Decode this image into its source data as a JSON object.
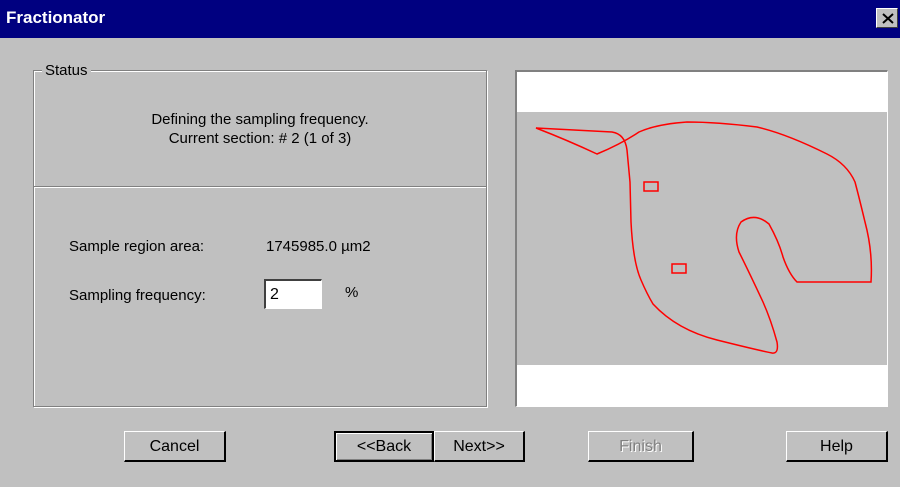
{
  "window": {
    "title": "Fractionator"
  },
  "status": {
    "legend": "Status",
    "line1": "Defining the sampling frequency.",
    "line2": "Current section: # 2 (1 of 3)",
    "area_label": "Sample region area:",
    "area_value": "1745985.0 µm2",
    "freq_label": "Sampling frequency:",
    "freq_value": "2",
    "freq_unit": "%"
  },
  "buttons": {
    "cancel": "Cancel",
    "back": "<<Back",
    "next": "Next>>",
    "finish": "Finish",
    "help": "Help"
  },
  "colors": {
    "title_bar": "#000080",
    "dialog_face": "#c0c0c0",
    "contour": "#ff0000"
  }
}
